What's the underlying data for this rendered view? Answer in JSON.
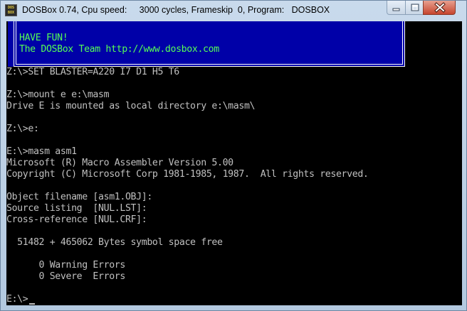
{
  "window": {
    "title": "DOSBox 0.74, Cpu speed:     3000 cycles, Frameskip  0, Program:   DOSBOX",
    "icon_text_top": "DOS",
    "icon_text_bottom": "BOX"
  },
  "banner": {
    "line1": "HAVE FUN!",
    "line2": "The DOSBox Team http://www.dosbox.com"
  },
  "terminal": {
    "lines": [
      "Z:\\>SET BLASTER=A220 I7 D1 H5 T6",
      "",
      "Z:\\>mount e e:\\masm",
      "Drive E is mounted as local directory e:\\masm\\",
      "",
      "Z:\\>e:",
      "",
      "E:\\>masm asm1",
      "Microsoft (R) Macro Assembler Version 5.00",
      "Copyright (C) Microsoft Corp 1981-1985, 1987.  All rights reserved.",
      "",
      "Object filename [asm1.OBJ]:",
      "Source listing  [NUL.LST]:",
      "Cross-reference [NUL.CRF]:",
      "",
      "  51482 + 465062 Bytes symbol space free",
      "",
      "      0 Warning Errors",
      "      0 Severe  Errors",
      "",
      "E:\\>"
    ]
  },
  "colors": {
    "terminal_bg": "#000000",
    "terminal_text": "#c0c0c0",
    "banner_bg": "#0000a8",
    "banner_text": "#55ff55"
  },
  "icons": {
    "app": "dosbox-icon",
    "minimize": "minimize-icon",
    "maximize": "maximize-icon",
    "close": "close-icon"
  }
}
